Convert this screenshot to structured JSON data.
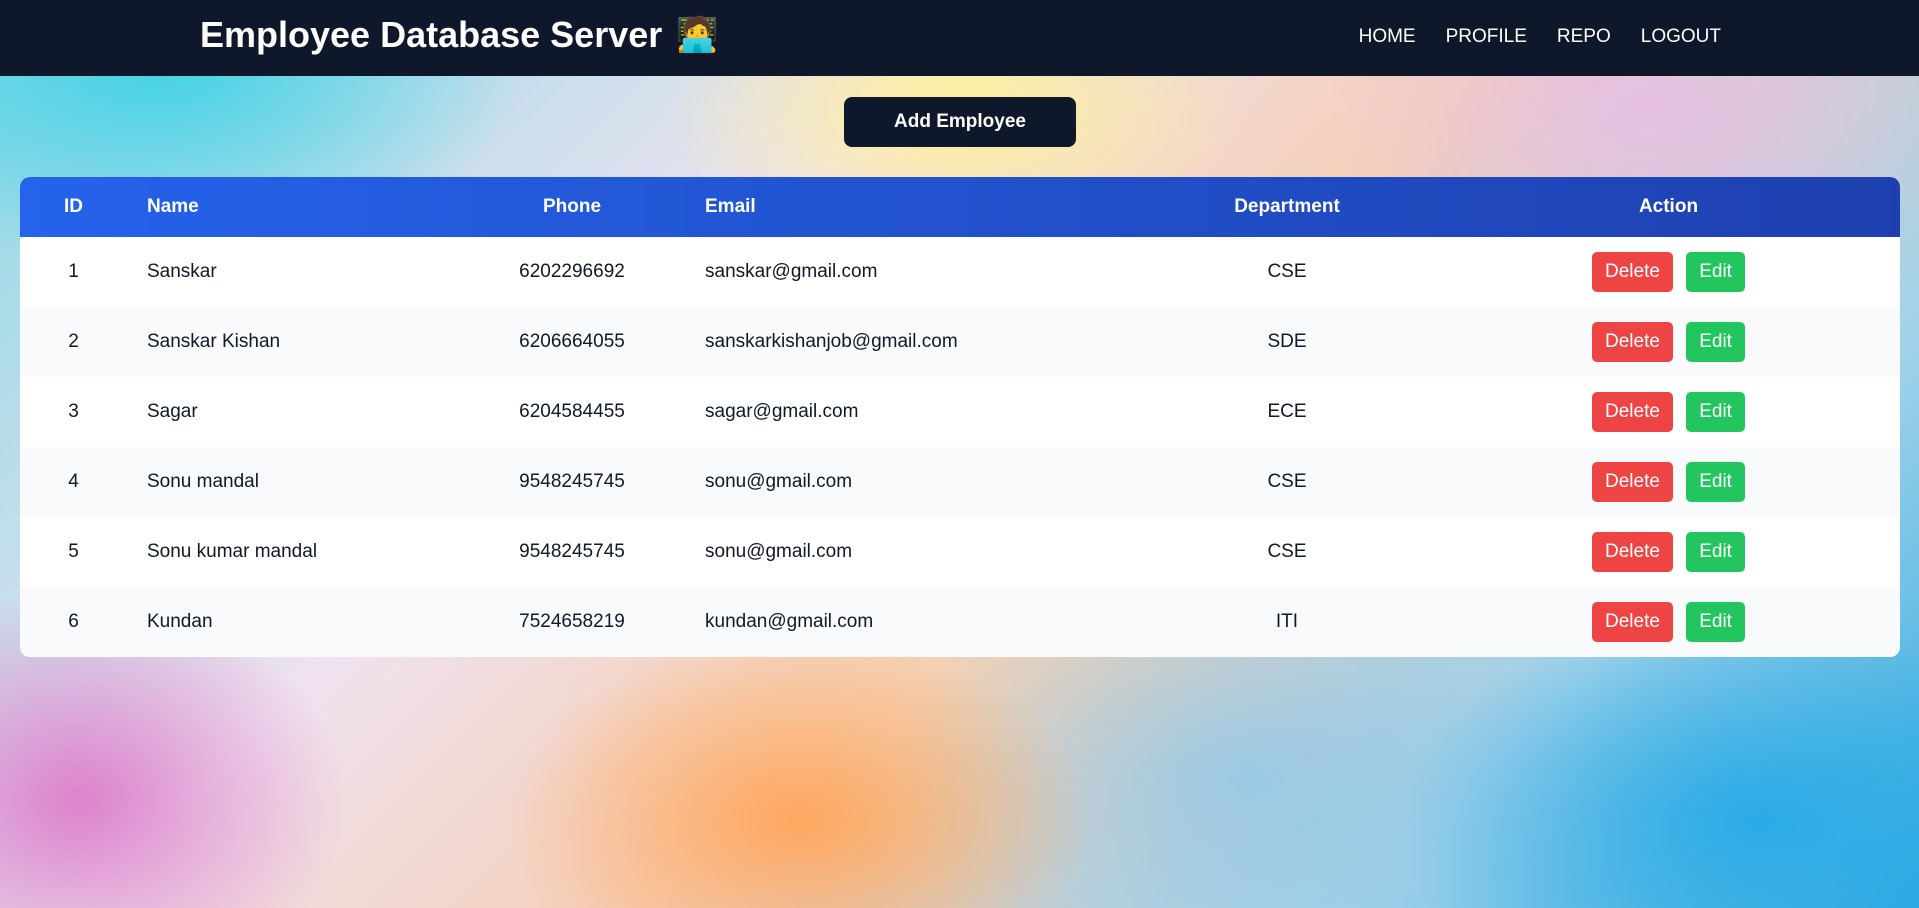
{
  "navbar": {
    "title": "Employee Database Server",
    "title_icon": "🧑‍💻",
    "links": [
      "HOME",
      "PROFILE",
      "REPO",
      "LOGOUT"
    ]
  },
  "add_button_label": "Add Employee",
  "table": {
    "headers": {
      "id": "ID",
      "name": "Name",
      "phone": "Phone",
      "email": "Email",
      "department": "Department",
      "action": "Action"
    },
    "rows": [
      {
        "id": "1",
        "name": "Sanskar",
        "phone": "6202296692",
        "email": "sanskar@gmail.com",
        "department": "CSE"
      },
      {
        "id": "2",
        "name": "Sanskar Kishan",
        "phone": "6206664055",
        "email": "sanskarkishanjob@gmail.com",
        "department": "SDE"
      },
      {
        "id": "3",
        "name": "Sagar",
        "phone": "6204584455",
        "email": "sagar@gmail.com",
        "department": "ECE"
      },
      {
        "id": "4",
        "name": "Sonu mandal",
        "phone": "9548245745",
        "email": "sonu@gmail.com",
        "department": "CSE"
      },
      {
        "id": "5",
        "name": "Sonu kumar mandal",
        "phone": "9548245745",
        "email": "sonu@gmail.com",
        "department": "CSE"
      },
      {
        "id": "6",
        "name": "Kundan",
        "phone": "7524658219",
        "email": "kundan@gmail.com",
        "department": "ITI"
      }
    ],
    "delete_label": "Delete",
    "edit_label": "Edit"
  },
  "colors": {
    "navbar_bg": "#0f172a",
    "header_bg_start": "#2563eb",
    "header_bg_end": "#1e40af",
    "delete": "#ef4444",
    "edit": "#22c55e"
  }
}
